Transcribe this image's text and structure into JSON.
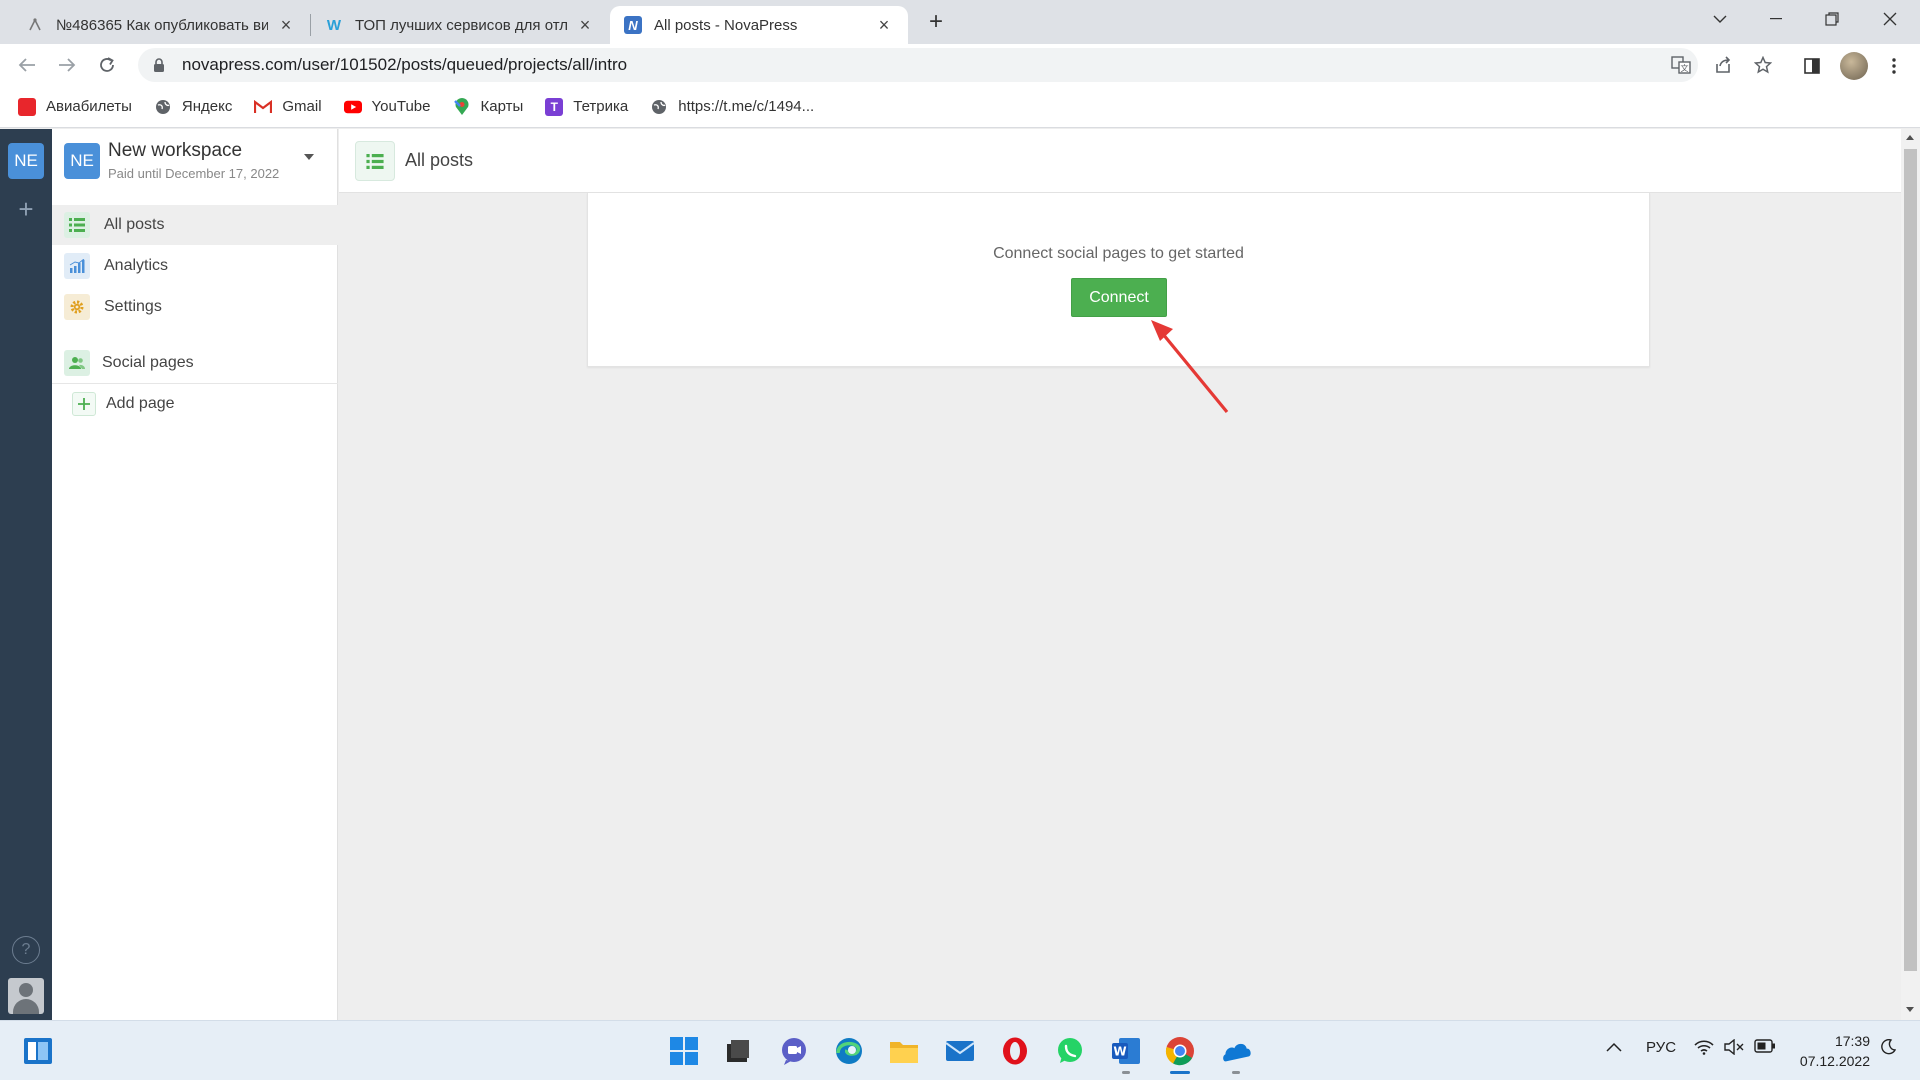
{
  "browser": {
    "tabs": [
      {
        "title": "№486365 Как опубликовать ви",
        "icon": "flow-icon",
        "active": false
      },
      {
        "title": "ТОП лучших сервисов для отло",
        "icon": "w-logo-icon",
        "active": false
      },
      {
        "title": "All posts - NovaPress",
        "icon": "novapress-icon",
        "active": true
      }
    ],
    "url": "novapress.com/user/101502/posts/queued/projects/all/intro",
    "bookmarks": [
      {
        "label": "Авиабилеты",
        "icon": "tickets-icon"
      },
      {
        "label": "Яндекс",
        "icon": "globe-icon"
      },
      {
        "label": "Gmail",
        "icon": "gmail-icon"
      },
      {
        "label": "YouTube",
        "icon": "youtube-icon"
      },
      {
        "label": "Карты",
        "icon": "maps-icon"
      },
      {
        "label": "Тетрика",
        "icon": "tetrika-icon"
      },
      {
        "label": "https://t.me/c/1494...",
        "icon": "globe-icon"
      }
    ]
  },
  "rail": {
    "workspace_initials": "NE",
    "add_label": "+",
    "help_label": "?"
  },
  "sidebar": {
    "workspace": {
      "initials": "NE",
      "name": "New workspace",
      "paid_until": "Paid until December 17, 2022"
    },
    "items": [
      {
        "label": "All posts",
        "icon": "list-icon",
        "active": true
      },
      {
        "label": "Analytics",
        "icon": "chart-icon",
        "active": false
      },
      {
        "label": "Settings",
        "icon": "gear-icon",
        "active": false
      },
      {
        "label": "Social pages",
        "icon": "users-icon",
        "active": false
      },
      {
        "label": "Add page",
        "icon": "plus-icon",
        "active": false
      }
    ]
  },
  "header": {
    "title": "All posts"
  },
  "main": {
    "prompt": "Connect social pages to get started",
    "connect_label": "Connect"
  },
  "colors": {
    "accent_green": "#4caf50",
    "rail_bg": "#2d3e50",
    "workspace_blue": "#4a90d9",
    "annotation_red": "#e53935"
  },
  "taskbar": {
    "apps": [
      "start-icon",
      "file-manager-icon",
      "teams-chat-icon",
      "edge-icon",
      "explorer-icon",
      "mail-icon",
      "opera-icon",
      "whatsapp-icon",
      "word-icon",
      "chrome-icon",
      "onedrive-icon"
    ],
    "language": "РУС",
    "time": "17:39",
    "date": "07.12.2022"
  }
}
